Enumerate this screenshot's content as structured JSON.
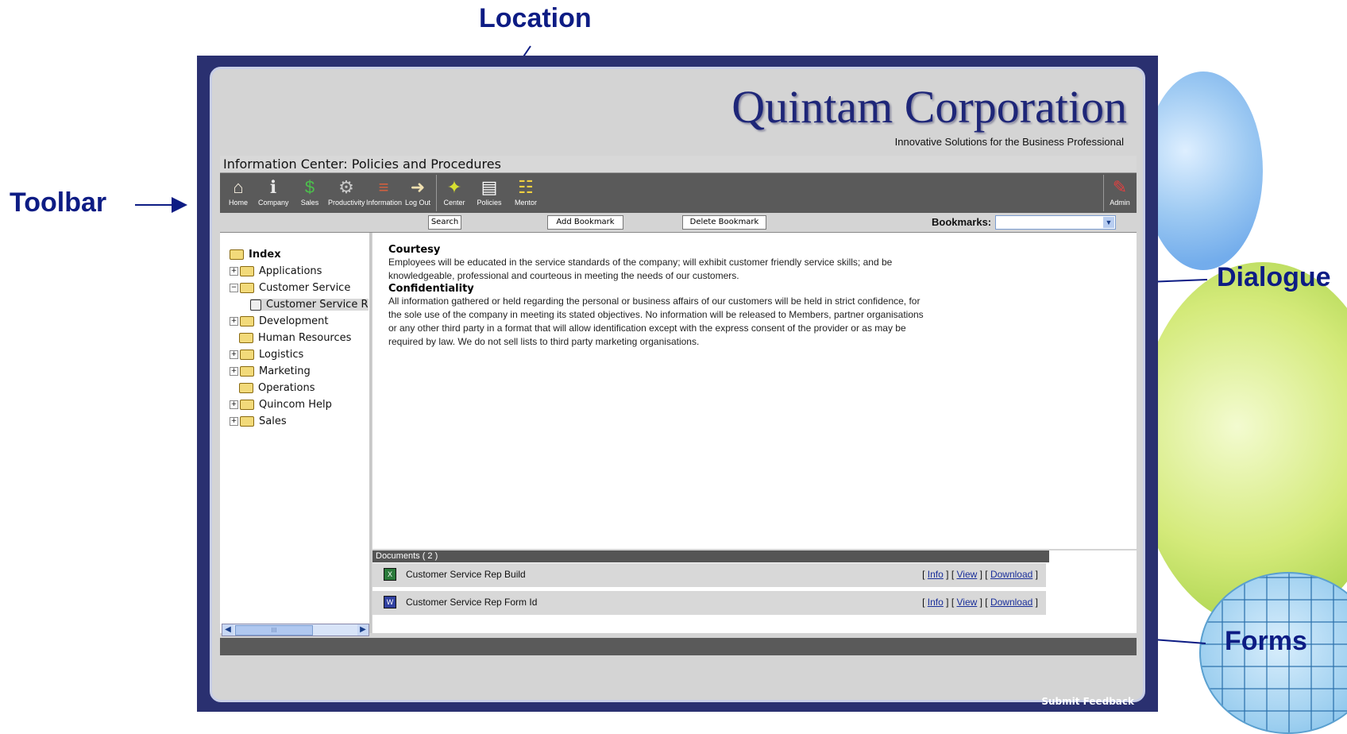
{
  "annotations": {
    "location": "Location",
    "toolbar": "Toolbar",
    "dialogue": "Dialogue",
    "forms": "Forms"
  },
  "header": {
    "company": "Quintam Corporation",
    "tagline": "Innovative Solutions for the Business Professional"
  },
  "title": "Information Center: Policies and Procedures",
  "toolbar": {
    "home": "Home",
    "company": "Company",
    "sales": "Sales",
    "productivity": "Productivity",
    "information": "Information",
    "logout": "Log Out",
    "center": "Center",
    "policies": "Policies",
    "mentor": "Mentor",
    "admin": "Admin"
  },
  "actions": {
    "search": "Search",
    "add_bookmark": "Add Bookmark",
    "delete_bookmark": "Delete Bookmark",
    "bookmarks_label": "Bookmarks:"
  },
  "tree": {
    "root": "Index",
    "items": [
      "Applications",
      "Customer Service",
      "Customer Service R",
      "Development",
      "Human Resources",
      "Logistics",
      "Marketing",
      "Operations",
      "Quincom Help",
      "Sales"
    ],
    "scroll_thumb_label": "III"
  },
  "content": {
    "h1": "Courtesy",
    "p1": "Employees will be educated in the service standards of the company; will exhibit customer friendly service skills; and be knowledgeable, professional and courteous in meeting the needs of our customers.",
    "h2": "Confidentiality",
    "p2": "All information gathered or held regarding the personal or business affairs of our customers will be held in strict confidence, for the sole use of the company in meeting its stated objectives. No information will be released to Members, partner organisations or any other third party in a format that will allow identification except with the express consent of the provider or as may be required by law. We do not sell lists to third party marketing organisations."
  },
  "documents": {
    "header": "Documents ( 2 )",
    "items": [
      {
        "name": "Customer Service Rep Build",
        "info": "Info",
        "view": "View",
        "download": "Download"
      },
      {
        "name": "Customer Service Rep Form Id",
        "info": "Info",
        "view": "View",
        "download": "Download"
      }
    ]
  },
  "footer": {
    "feedback": "Submit Feedback"
  }
}
